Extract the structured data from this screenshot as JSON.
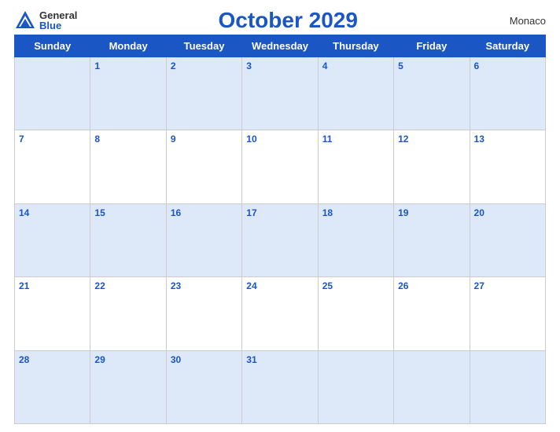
{
  "header": {
    "logo_general": "General",
    "logo_blue": "Blue",
    "title": "October 2029",
    "country": "Monaco"
  },
  "days_of_week": [
    "Sunday",
    "Monday",
    "Tuesday",
    "Wednesday",
    "Thursday",
    "Friday",
    "Saturday"
  ],
  "weeks": [
    [
      "",
      "1",
      "2",
      "3",
      "4",
      "5",
      "6"
    ],
    [
      "7",
      "8",
      "9",
      "10",
      "11",
      "12",
      "13"
    ],
    [
      "14",
      "15",
      "16",
      "17",
      "18",
      "19",
      "20"
    ],
    [
      "21",
      "22",
      "23",
      "24",
      "25",
      "26",
      "27"
    ],
    [
      "28",
      "29",
      "30",
      "31",
      "",
      "",
      ""
    ]
  ]
}
